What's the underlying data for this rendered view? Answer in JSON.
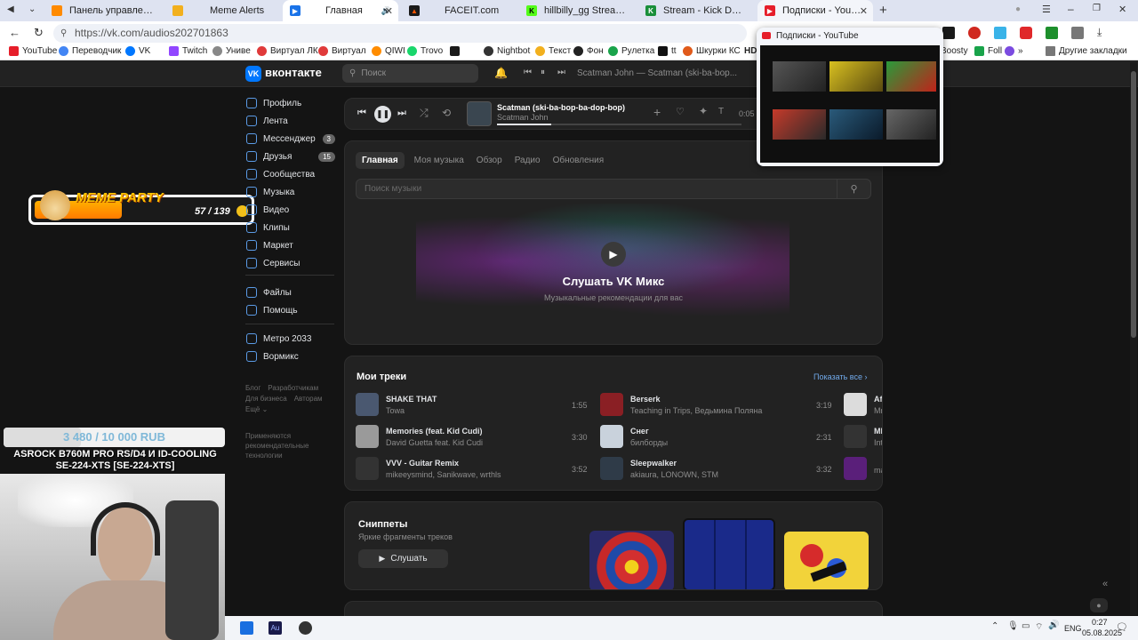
{
  "browser": {
    "tabs": [
      {
        "label": "Панель управления - Пан",
        "color": "#ff8a00"
      },
      {
        "label": "Meme Alerts",
        "color": "#f2b01e"
      },
      {
        "label": "Главная",
        "color": "#1a73e8"
      },
      {
        "label": "FACEIT.com",
        "color": "#ff5500"
      },
      {
        "label": "hillbilly_gg Stream - Watch",
        "color": "#53fc18"
      },
      {
        "label": "Stream - Kick Dashboard",
        "color": "#1a8f3a"
      },
      {
        "label": "Подписки - YouTube",
        "color": "#e61e2a"
      }
    ],
    "url": "https://vk.com/audios202701863",
    "bookmarks": [
      "YouTube",
      "Переводчик",
      "VK",
      "Twitch",
      "Униве",
      "Виртуал ЛК",
      "Виртуал",
      "QIWI",
      "Trovo",
      "Nightbot",
      "Текст",
      "Фон",
      "Рулетка",
      "tt",
      "Шкурки КС",
      "HD"
    ],
    "bookmarks_right": [
      "Boosty",
      "Foll",
      "Другие закладки"
    ],
    "tab_preview_title": "Подписки - YouTube"
  },
  "vk": {
    "logo_text": "вконтакте",
    "search_placeholder": "Поиск",
    "now_playing_header": "Scatman John — Scatman (ski-ba-bop...",
    "sidebar": [
      {
        "label": "Профиль",
        "badge": ""
      },
      {
        "label": "Лента",
        "badge": ""
      },
      {
        "label": "Мессенджер",
        "badge": "3"
      },
      {
        "label": "Друзья",
        "badge": "15"
      },
      {
        "label": "Сообщества",
        "badge": ""
      },
      {
        "label": "Музыка",
        "badge": ""
      },
      {
        "label": "Видео",
        "badge": ""
      },
      {
        "label": "Клипы",
        "badge": ""
      },
      {
        "label": "Маркет",
        "badge": ""
      },
      {
        "label": "Сервисы",
        "badge": ""
      }
    ],
    "sidebar2": [
      "Файлы",
      "Помощь"
    ],
    "sidebar3": [
      "Метро 2033",
      "Вормикс"
    ],
    "footer_links": [
      "Блог",
      "Разработчикам",
      "Для бизнеса",
      "Авторам",
      "Ещё"
    ],
    "footer_note": "Применяются рекомендательные технологии",
    "player": {
      "title": "Scatman (ski-ba-bop-ba-dop-bop)",
      "artist": "Scatman John",
      "time": "0:05",
      "progress": 0.22
    },
    "music_tabs": [
      "Главная",
      "Моя музыка",
      "Обзор",
      "Радио",
      "Обновления"
    ],
    "music_search_placeholder": "Поиск музыки",
    "mix": {
      "title": "Слушать VK Микс",
      "subtitle": "Музыкальные рекомендации для вас"
    },
    "my_tracks": {
      "heading": "Мои треки",
      "show_all": "Показать все",
      "tracks": [
        {
          "title": "SHAKE THAT",
          "artist": "Towa",
          "duration": "1:55",
          "color": "#4a5870"
        },
        {
          "title": "Berserk",
          "artist": "Teaching in Trips, Ведьмина Поляна",
          "duration": "3:19",
          "color": "#8a1f24"
        },
        {
          "title": "Af",
          "artist": "Mr",
          "duration": "",
          "color": "#dcdcdc"
        },
        {
          "title": "Memories (feat. Kid Cudi)",
          "artist": "David Guetta feat. Kid Cudi",
          "duration": "3:30",
          "color": "#9a9a9a"
        },
        {
          "title": "Снег",
          "artist": "билборды",
          "duration": "2:31",
          "color": "#c9d2dc"
        },
        {
          "title": "ME",
          "artist": "Int",
          "duration": "",
          "color": "#333"
        },
        {
          "title": "VVV - Guitar Remix",
          "artist": "mikeeysmind, Sanikwave, wrthls",
          "duration": "3:52",
          "color": "#333333"
        },
        {
          "title": "Sleepwalker",
          "artist": "akiaura, LONOWN, STM",
          "duration": "3:32",
          "color": "#2f3b48"
        },
        {
          "title": "",
          "artist": "ma",
          "duration": "",
          "color": "#5a1f7a"
        }
      ]
    },
    "snippets": {
      "title": "Сниппеты",
      "subtitle": "Яркие фрагменты треков",
      "button": "Слушать"
    }
  },
  "overlay": {
    "meme_party": "MEME PARTY",
    "meme_count": "57 / 139",
    "meme_progress": 0.41,
    "donation": "3 480 / 10 000 RUB",
    "donation_goal": "ASROCK B760M PRO RS/D4 И ID-COOLING SE-224-XTS [SE-224-XTS]"
  },
  "taskbar": {
    "lang": "ENG",
    "time": "0:27",
    "date": "05.08.2025"
  }
}
